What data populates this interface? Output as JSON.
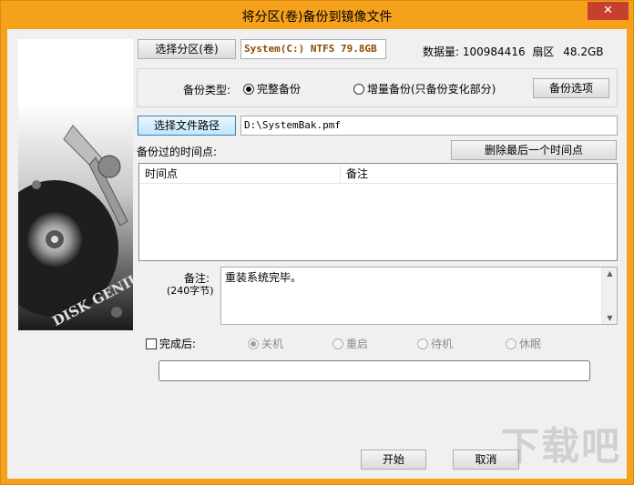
{
  "window": {
    "title": "将分区(卷)备份到镜像文件",
    "close_glyph": "✕",
    "accent": "#f5a11c",
    "close_color": "#c7402f"
  },
  "partition": {
    "select_button": "选择分区(卷)",
    "info": "System(C:) NTFS 79.8GB",
    "data_label": "数据量:",
    "data_value": "100984416",
    "sector_label": "扇区",
    "size": "48.2GB"
  },
  "backup_type": {
    "label": "备份类型:",
    "options": [
      {
        "label": "完整备份",
        "selected": true
      },
      {
        "label": "增量备份(只备份变化部分)",
        "selected": false
      }
    ],
    "options_button": "备份选项"
  },
  "file": {
    "select_button": "选择文件路径",
    "path": "D:\\SystemBak.pmf"
  },
  "timepoints": {
    "label": "备份过的时间点:",
    "delete_button": "删除最后一个时间点",
    "columns": [
      "时间点",
      "备注"
    ]
  },
  "note": {
    "label": "备注:",
    "sublabel": "(240字节)",
    "text": "重装系统完毕。"
  },
  "after": {
    "checkbox_label": "完成后:",
    "options": [
      {
        "label": "关机",
        "selected": true
      },
      {
        "label": "重启",
        "selected": false
      },
      {
        "label": "待机",
        "selected": false
      },
      {
        "label": "休眠",
        "selected": false
      }
    ]
  },
  "actions": {
    "start": "开始",
    "cancel": "取消"
  },
  "art": {
    "brand_text": "DISK GENIUS"
  },
  "watermark": "下载吧"
}
